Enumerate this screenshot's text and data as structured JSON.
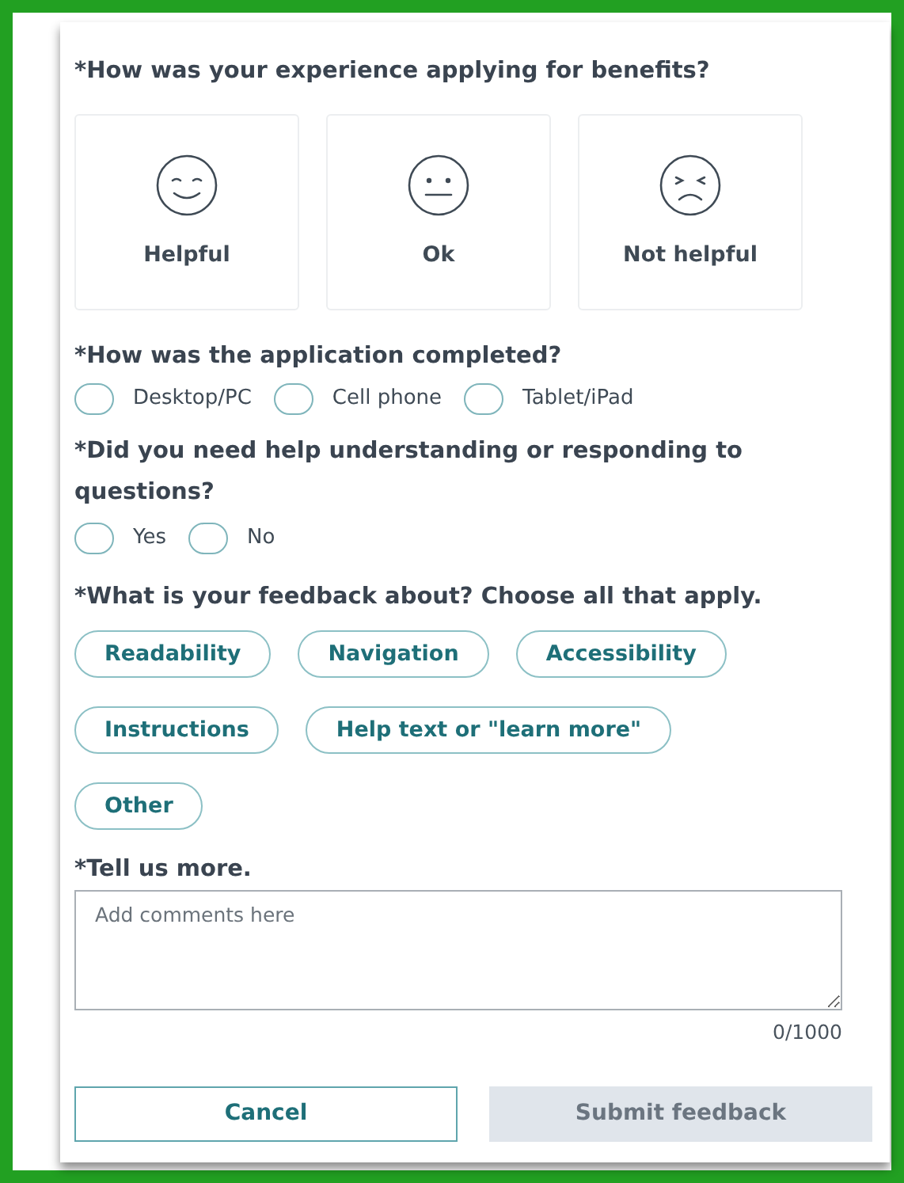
{
  "experience": {
    "question": "*How was your experience applying for benefits?",
    "options": [
      {
        "kind": "happy",
        "label": "Helpful",
        "selected": false
      },
      {
        "kind": "neutral",
        "label": "Ok",
        "selected": false
      },
      {
        "kind": "sad",
        "label": "Not helpful",
        "selected": false
      }
    ]
  },
  "completed": {
    "question": "*How was the application completed?",
    "options": [
      {
        "label": "Desktop/PC",
        "selected": false
      },
      {
        "label": "Cell phone",
        "selected": false
      },
      {
        "label": "Tablet/iPad",
        "selected": false
      }
    ]
  },
  "help": {
    "question": "*Did you need help understanding or responding to questions?",
    "options": [
      {
        "label": "Yes",
        "selected": false
      },
      {
        "label": "No",
        "selected": false
      }
    ]
  },
  "topics": {
    "question": "*What is your feedback about? Choose all that apply.",
    "rows": [
      [
        {
          "label": "Readability",
          "selected": false
        },
        {
          "label": "Navigation",
          "selected": false
        },
        {
          "label": "Accessibility",
          "selected": false
        }
      ],
      [
        {
          "label": "Instructions",
          "selected": false
        },
        {
          "label": "Help text or \"learn more\"",
          "selected": false
        }
      ],
      [
        {
          "label": "Other",
          "selected": false
        }
      ]
    ]
  },
  "comments": {
    "label": "*Tell us more.",
    "placeholder": "Add comments here",
    "counter": "0/1000"
  },
  "buttons": {
    "cancel": "Cancel",
    "submit": {
      "label": "Submit feedback",
      "disabled": true
    }
  }
}
